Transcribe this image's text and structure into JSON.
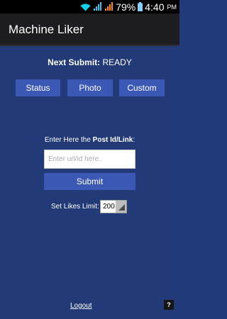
{
  "status_bar": {
    "wifi_icon": "wifi-icon",
    "signal_icons": [
      "signal-icon",
      "signal-icon"
    ],
    "battery_percent": "79%",
    "battery_icon": "battery-icon",
    "time": "4:40",
    "ampm": "PM",
    "colors": {
      "wifi": "#0fd0e8",
      "signal1": "#39c5f0",
      "signal2": "#ff8a00",
      "battery": "#8acdff"
    }
  },
  "action_bar": {
    "title": "Machine Liker"
  },
  "main": {
    "next_submit_label": "Next Submit:",
    "next_submit_value": "READY",
    "tabs": [
      {
        "label": "Status"
      },
      {
        "label": "Photo"
      },
      {
        "label": "Custom"
      }
    ],
    "post_label_prefix": "Enter Here the ",
    "post_label_bold": "Post Id/Link",
    "post_label_suffix": ":",
    "url_input": {
      "placeholder": "Enter url/id here.",
      "value": ""
    },
    "submit_label": "Submit",
    "likes_limit_label": "Set Likes Limit:",
    "likes_limit_value": "200",
    "logout_label": "Logout",
    "help_label": "?"
  },
  "colors": {
    "background": "#223a78",
    "button": "#3b58b5",
    "action_bar": "#1d1d1f"
  }
}
